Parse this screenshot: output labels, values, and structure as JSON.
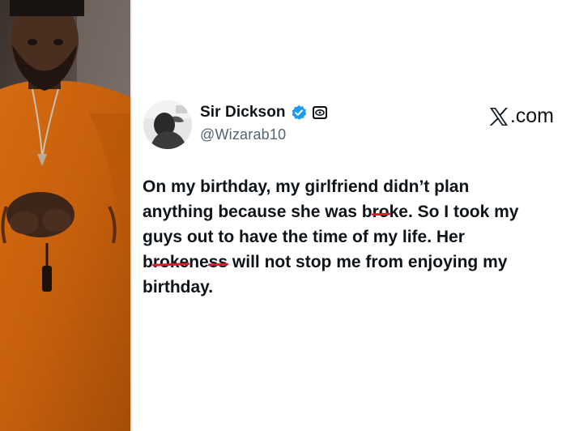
{
  "photo": {
    "description_icon": "person-photo"
  },
  "tweet": {
    "display_name": "Sir Dickson",
    "handle": "@Wizarab10",
    "brand_label": ".com",
    "verified_icon": "verified-badge-icon",
    "affiliate_icon": "affiliate-badge-icon",
    "brand_icon": "x-logo-icon",
    "text_lines": {
      "l1": "On my birthday, my girlfriend didn’t plan",
      "l2_pre": "anything because she was b",
      "l2_struck": "ro",
      "l2_post": "ke. So I took my",
      "l3": "guys out to have the time of my life. Her",
      "l4_pre": "b",
      "l4_struck1": "roke",
      "l4_mid": "ne",
      "l4_struck2": "ss",
      "l4_post": " will not stop me from enjoying my",
      "l5": "birthday."
    },
    "accent_color": "#1d9bf0",
    "strike_color": "#d3202a"
  }
}
